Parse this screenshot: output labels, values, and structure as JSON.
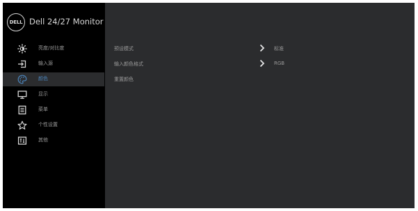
{
  "header": {
    "logo_text": "DELL",
    "title": "Dell 24/27 Monitor"
  },
  "sidebar": {
    "items": [
      {
        "label": "亮度/对比度",
        "icon": "brightness-icon",
        "active": false
      },
      {
        "label": "输入源",
        "icon": "input-source-icon",
        "active": false
      },
      {
        "label": "颜色",
        "icon": "color-palette-icon",
        "active": true
      },
      {
        "label": "显示",
        "icon": "display-icon",
        "active": false
      },
      {
        "label": "菜单",
        "icon": "menu-list-icon",
        "active": false
      },
      {
        "label": "个性设置",
        "icon": "star-icon",
        "active": false
      },
      {
        "label": "其他",
        "icon": "other-settings-icon",
        "active": false
      }
    ]
  },
  "main": {
    "rows": [
      {
        "label": "预设模式",
        "value": "标准",
        "chevron": true
      },
      {
        "label": "输入颜色格式",
        "value": "RGB",
        "chevron": true
      },
      {
        "label": "重置颜色",
        "value": "",
        "chevron": false
      }
    ]
  },
  "colors": {
    "active_text": "#4a82b8",
    "panel_bg": "#2b2c2e",
    "sidebar_bg": "#000000"
  }
}
